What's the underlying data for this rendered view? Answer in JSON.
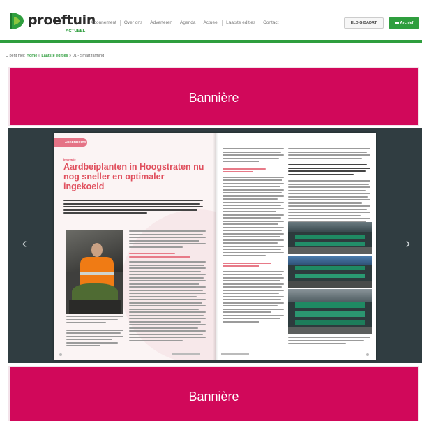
{
  "header": {
    "logo_text": "proeftuin",
    "logo_sub": "ACTUEEL",
    "nav": [
      "Abonnement",
      "Over ons",
      "Adverteren",
      "Agenda",
      "Actueel",
      "Laatste edities",
      "Contact"
    ],
    "bladeren_label": "ELDIG BADRT",
    "archief_label": "Archief",
    "accent_color": "#2f9e3e"
  },
  "breadcrumb": {
    "prefix": "U bent hier:",
    "items": [
      "Home",
      "Laatste edities",
      "01 - Smart farming"
    ],
    "separator": "»"
  },
  "banners": {
    "top_label": "Bannière",
    "bottom_label": "Bannière",
    "color": "#d1085a"
  },
  "viewer": {
    "prev_icon": "‹",
    "next_icon": "›",
    "article": {
      "tag": "AKKERBOUW",
      "kicker": "Innovatie",
      "headline": "Aardbeiplanten in Hoogstraten nu nog sneller en optimaler ingekoeld",
      "headline_color": "#e0505e"
    }
  }
}
